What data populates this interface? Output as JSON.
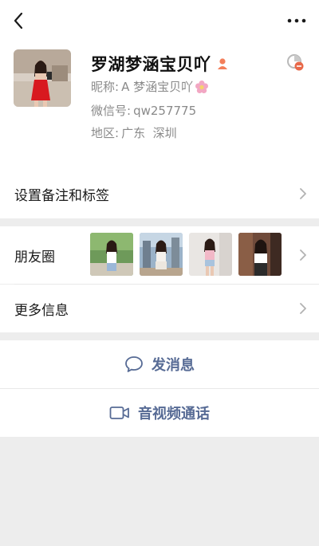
{
  "profile": {
    "name": "罗湖梦涵宝贝吖",
    "nickname_label": "昵称:",
    "nickname_value": "A 梦涵宝贝吖",
    "wechat_id_label": "微信号:",
    "wechat_id_value": "qw257775",
    "region_label": "地区:",
    "region_value": "广东  深圳"
  },
  "cells": {
    "remark_label": "设置备注和标签",
    "moments_label": "朋友圈",
    "more_info_label": "更多信息"
  },
  "actions": {
    "message_label": "发消息",
    "video_call_label": "音视频通话"
  },
  "colors": {
    "link": "#576b95",
    "gender_female": "#f37e5a",
    "background": "#ededed"
  },
  "icons": {
    "back": "back-chevron-icon",
    "more": "more-dots-icon",
    "gender": "female-icon",
    "star": "star-friend-icon",
    "message": "chat-bubble-icon",
    "video": "video-camera-icon",
    "chevron": "chevron-right-icon"
  }
}
